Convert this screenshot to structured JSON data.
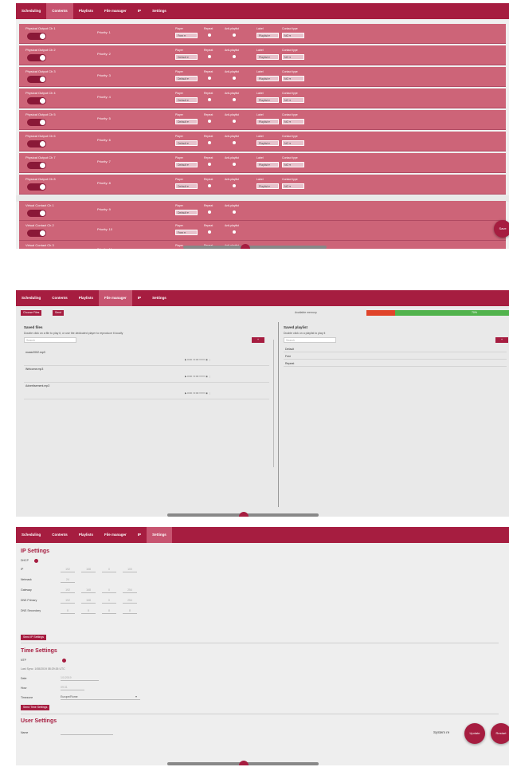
{
  "screen1": {
    "tabs": [
      "Scheduling",
      "Contents",
      "Playlists",
      "File manager",
      "IP",
      "Settings"
    ],
    "active_tab": 1,
    "physical_rows": [
      {
        "name": "Physical Output Ch 1",
        "priority": "Priority: 1",
        "player_label": "Player",
        "player": "Free",
        "repeat_label": "Repeat",
        "antiloop_label": "Anti-playlist",
        "label_label": "Label",
        "label": "Playlist",
        "contact_label": "Contact type",
        "contact": "NO"
      },
      {
        "name": "Physical Output Ch 2",
        "priority": "Priority: 2",
        "player_label": "Player",
        "player": "Default",
        "repeat_label": "Repeat",
        "antiloop_label": "Anti-playlist",
        "label_label": "Label",
        "label": "Playlist",
        "contact_label": "Contact type",
        "contact": "NO"
      },
      {
        "name": "Physical Output Ch 3",
        "priority": "Priority: 3",
        "player_label": "Player",
        "player": "Default",
        "repeat_label": "Repeat",
        "antiloop_label": "Anti-playlist",
        "label_label": "Label",
        "label": "Playlist",
        "contact_label": "Contact type",
        "contact": "NO"
      },
      {
        "name": "Physical Output Ch 4",
        "priority": "Priority: 4",
        "player_label": "Player",
        "player": "Default",
        "repeat_label": "Repeat",
        "antiloop_label": "Anti-playlist",
        "label_label": "Label",
        "label": "Playlist",
        "contact_label": "Contact type",
        "contact": "NO"
      },
      {
        "name": "Physical Output Ch 5",
        "priority": "Priority: 5",
        "player_label": "Player",
        "player": "Default",
        "repeat_label": "Repeat",
        "antiloop_label": "Anti-playlist",
        "label_label": "Label",
        "label": "Playlist",
        "contact_label": "Contact type",
        "contact": "NO"
      },
      {
        "name": "Physical Output Ch 6",
        "priority": "Priority: 6",
        "player_label": "Player",
        "player": "Default",
        "repeat_label": "Repeat",
        "antiloop_label": "Anti-playlist",
        "label_label": "Label",
        "label": "Playlist",
        "contact_label": "Contact type",
        "contact": "NO"
      },
      {
        "name": "Physical Output Ch 7",
        "priority": "Priority: 7",
        "player_label": "Player",
        "player": "Default",
        "repeat_label": "Repeat",
        "antiloop_label": "Anti-playlist",
        "label_label": "Label",
        "label": "Playlist",
        "contact_label": "Contact type",
        "contact": "NO"
      },
      {
        "name": "Physical Output Ch 8",
        "priority": "Priority: 8",
        "player_label": "Player",
        "player": "Default",
        "repeat_label": "Repeat",
        "antiloop_label": "Anti-playlist",
        "label_label": "Label",
        "label": "Playlist",
        "contact_label": "Contact type",
        "contact": "NO"
      }
    ],
    "virtual_rows": [
      {
        "name": "Virtual Contact Ch 1",
        "priority": "Priority: 9",
        "player_label": "Player",
        "player": "Default",
        "repeat_label": "Repeat",
        "antiloop_label": "Anti-playlist"
      },
      {
        "name": "Virtual Contact Ch 2",
        "priority": "Priority: 10",
        "player_label": "Player",
        "player": "Free",
        "repeat_label": "Repeat",
        "antiloop_label": "Anti-playlist"
      },
      {
        "name": "Virtual Contact Ch 3",
        "priority": "Priority: 11",
        "player_label": "Player",
        "player": "Default",
        "repeat_label": "Repeat",
        "antiloop_label": "Anti-playlist"
      }
    ],
    "save_button": "Save"
  },
  "screen2": {
    "tabs": [
      "Scheduling",
      "Contents",
      "Playlists",
      "File manager",
      "IP",
      "Settings"
    ],
    "active_tab": 3,
    "choose_file": "Choose Files",
    "send": "Send",
    "memory_label": "Available memory",
    "memory_used_fraction": 0.2,
    "memory_free_text": "70%",
    "saved_files_title": "Saved files",
    "saved_files_hint": "Double click on a file to play it, or use the dedicated player to reproduce it locally",
    "search_placeholder": "Search",
    "files": [
      {
        "name": "music2002.mp3",
        "time": "0:00 / 0:00"
      },
      {
        "name": "Welcome.mp3",
        "time": "0:00 / 0:00"
      },
      {
        "name": "Advertisement.mp3",
        "time": "0:00 / 0:00"
      }
    ],
    "saved_playlist_title": "Saved playlist",
    "saved_playlist_hint": "Double click on a playlist to play it",
    "playlists": [
      "Default",
      "Free",
      "Repeat"
    ],
    "add_symbol": "+"
  },
  "screen3": {
    "tabs": [
      "Scheduling",
      "Contents",
      "Playlists",
      "File manager",
      "IP",
      "Settings"
    ],
    "active_tab": 5,
    "ip_title": "IP Settings",
    "dhcp_label": "DHCP",
    "ip_fields": [
      {
        "label": "IP",
        "octets": [
          "192",
          "168",
          "0",
          "100"
        ]
      },
      {
        "label": "Netmask",
        "octets": [
          "24"
        ]
      },
      {
        "label": "Gateway",
        "octets": [
          "192",
          "168",
          "0",
          "254"
        ]
      },
      {
        "label": "DNS Primary",
        "octets": [
          "192",
          "168",
          "0",
          "254"
        ]
      },
      {
        "label": "DNS Secondary",
        "octets": [
          "8",
          "8",
          "8",
          "8"
        ]
      }
    ],
    "send_ip": "Send IP Settings",
    "time_title": "Time Settings",
    "ntp_label": "NTP",
    "last_sync": "Last Sync: 1/08/2019 08:29:26 UTC",
    "date_label": "Date",
    "date_value": "1/1/2019",
    "hour_label": "Hour",
    "hour_value": "09:31",
    "timezone_label": "Timezone",
    "timezone_value": "Europe/Rome",
    "send_time": "Send Time Settings",
    "user_title": "User Settings",
    "user_field_label": "Name",
    "system_label": "System re",
    "update_btn": "Update",
    "restart_btn": "Restart"
  },
  "colors": {
    "accent": "#a61d40",
    "row": "#cd6478",
    "memory_used": "#e0442a",
    "memory_free": "#52b34d"
  }
}
